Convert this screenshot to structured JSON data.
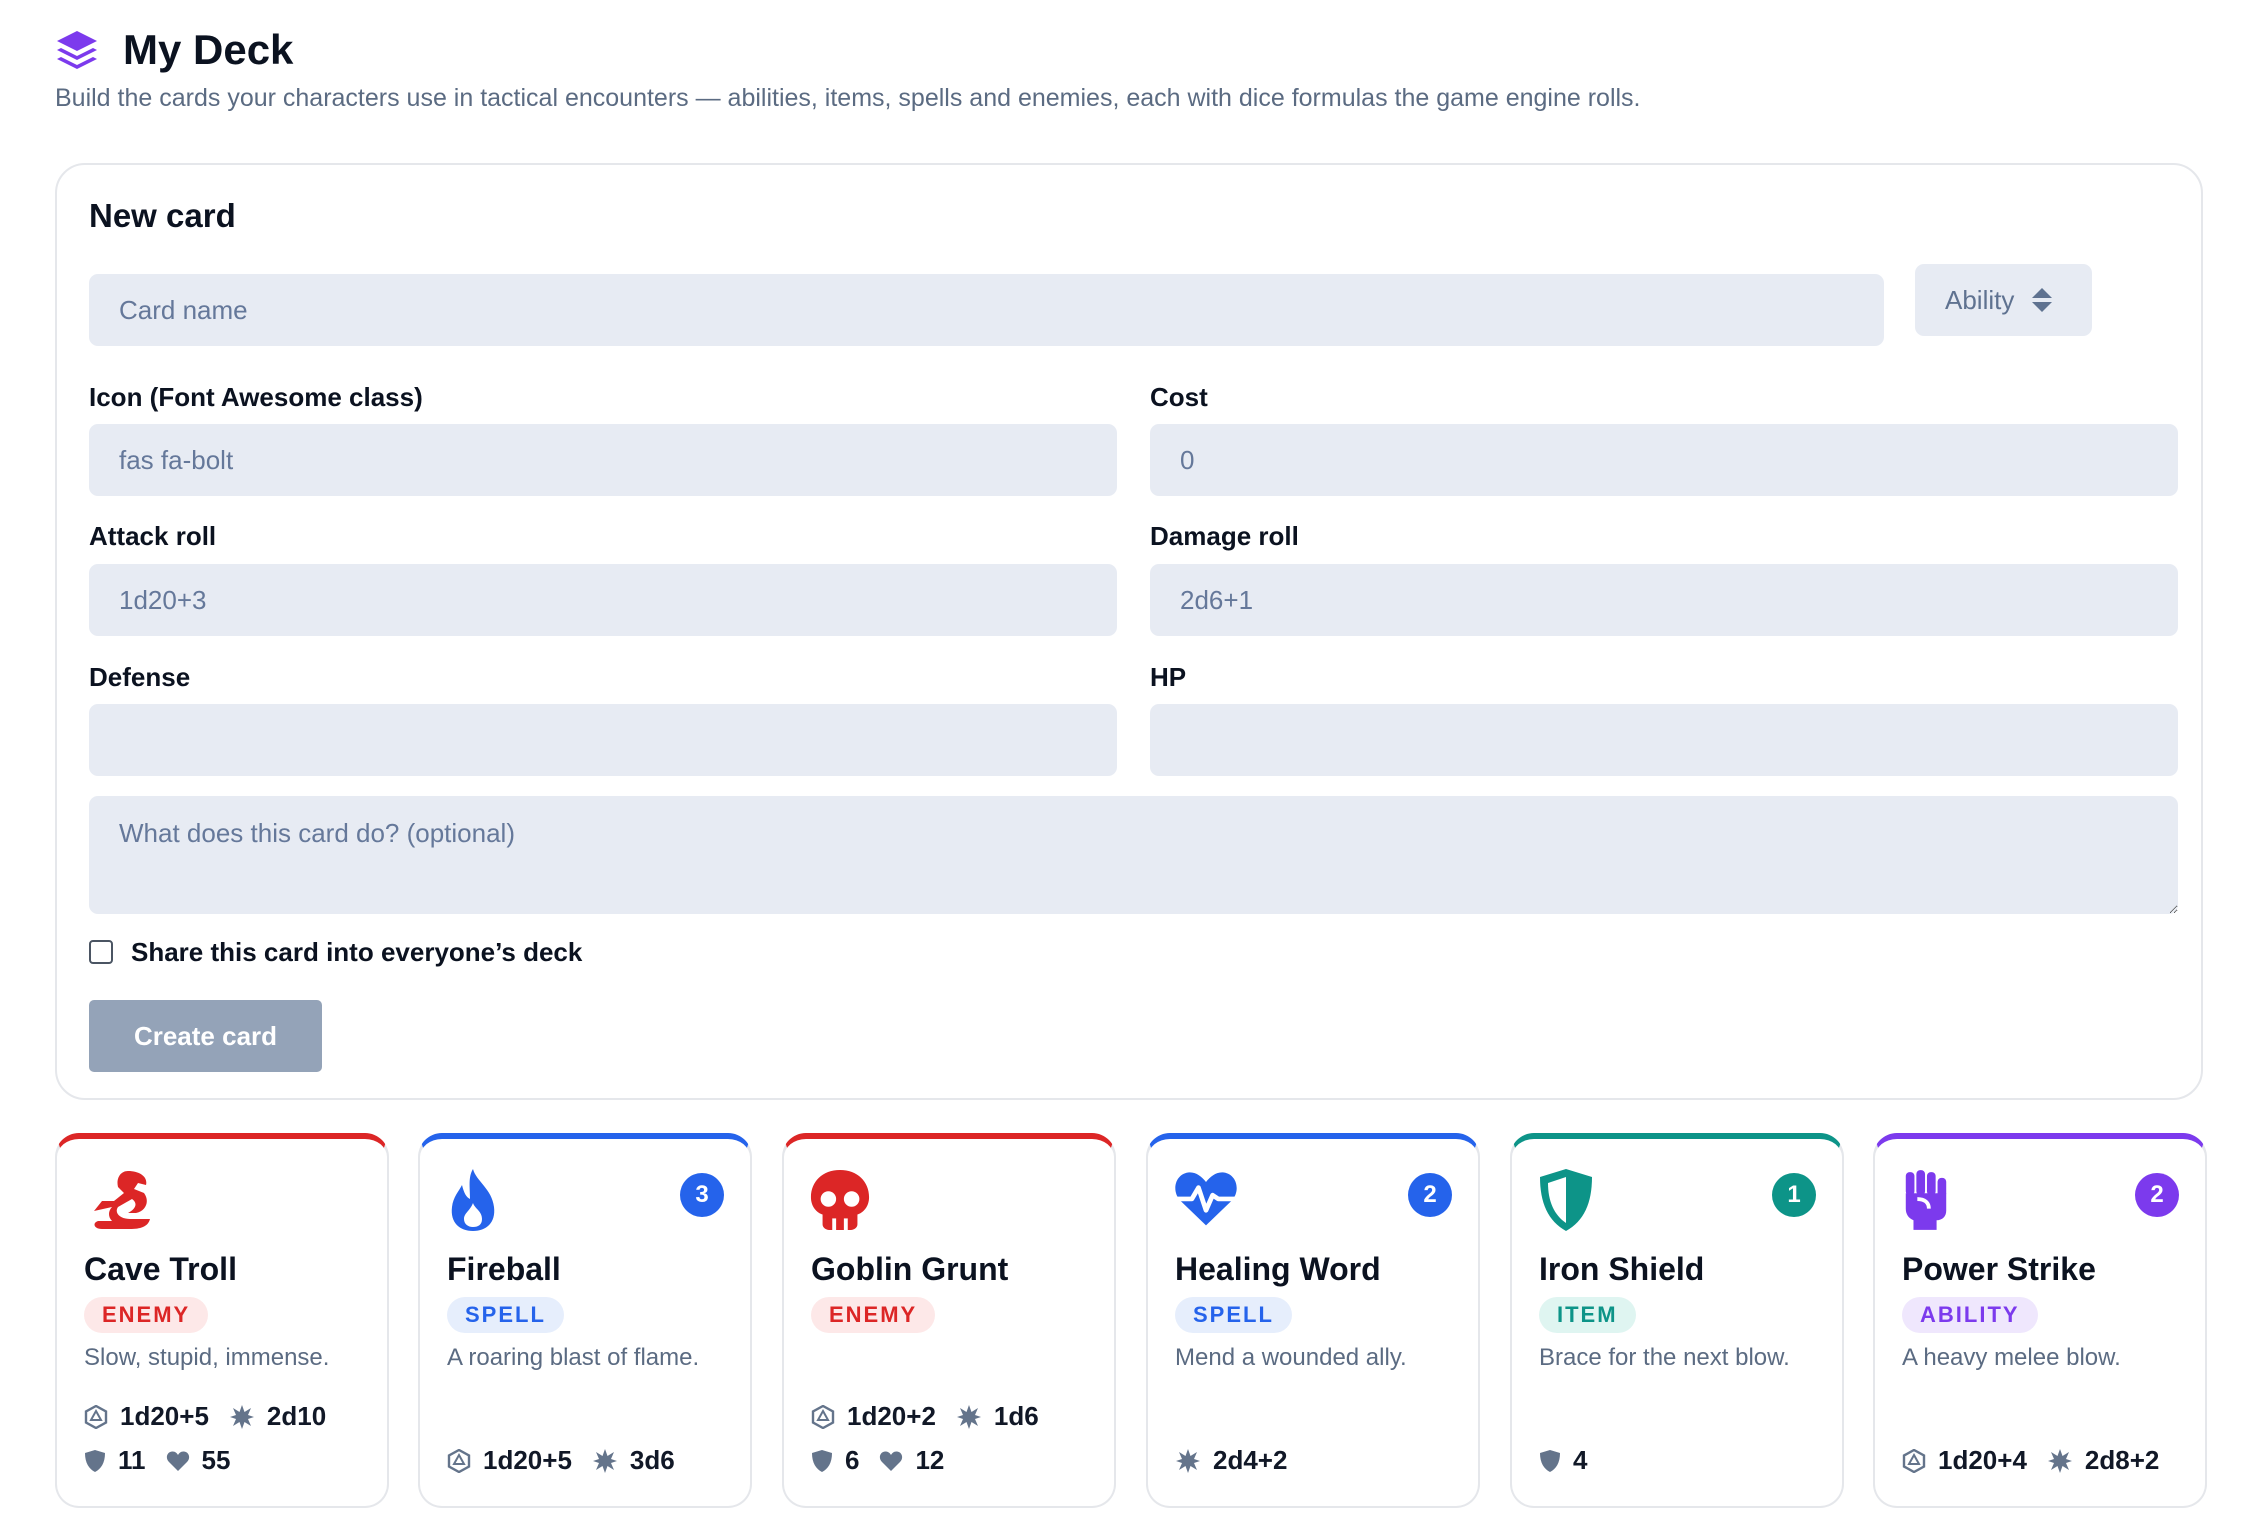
{
  "header": {
    "title": "My Deck",
    "subtitle": "Build the cards your characters use in tactical encounters — abilities, items, spells and enemies, each with dice formulas the game engine rolls."
  },
  "form": {
    "title": "New card",
    "name_placeholder": "Card name",
    "type_value": "Ability",
    "icon_label": "Icon (Font Awesome class)",
    "icon_placeholder": "fas fa-bolt",
    "cost_label": "Cost",
    "cost_placeholder": "0",
    "attack_label": "Attack roll",
    "attack_placeholder": "1d20+3",
    "damage_label": "Damage roll",
    "damage_placeholder": "2d6+1",
    "defense_label": "Defense",
    "defense_placeholder": "",
    "hp_label": "HP",
    "hp_placeholder": "",
    "description_placeholder": "What does this card do? (optional)",
    "share_label": "Share this card into everyone’s deck",
    "share_checked": false,
    "submit_label": "Create card"
  },
  "colors": {
    "enemy": "#dc2626",
    "spell": "#2563eb",
    "item": "#0d9488",
    "ability": "#7c3aed",
    "brand": "#7c3aed"
  },
  "cards": [
    {
      "name": "Cave Troll",
      "type": "ENEMY",
      "icon": "dragon-icon",
      "description": "Slow, stupid, immense.",
      "attack": "1d20+5",
      "damage": "2d10",
      "defense": "11",
      "hp": "55"
    },
    {
      "name": "Fireball",
      "type": "SPELL",
      "icon": "fire-icon",
      "cost": "3",
      "description": "A roaring blast of flame.",
      "attack": "1d20+5",
      "damage": "3d6"
    },
    {
      "name": "Goblin Grunt",
      "type": "ENEMY",
      "icon": "skull-icon",
      "description": "",
      "attack": "1d20+2",
      "damage": "1d6",
      "defense": "6",
      "hp": "12"
    },
    {
      "name": "Healing Word",
      "type": "SPELL",
      "icon": "heart-pulse-icon",
      "cost": "2",
      "description": "Mend a wounded ally.",
      "damage": "2d4+2"
    },
    {
      "name": "Iron Shield",
      "type": "ITEM",
      "icon": "shield-icon",
      "cost": "1",
      "description": "Brace for the next blow.",
      "defense": "4"
    },
    {
      "name": "Power Strike",
      "type": "ABILITY",
      "icon": "fist-icon",
      "cost": "2",
      "description": "A heavy melee blow.",
      "attack": "1d20+4",
      "damage": "2d8+2"
    }
  ]
}
